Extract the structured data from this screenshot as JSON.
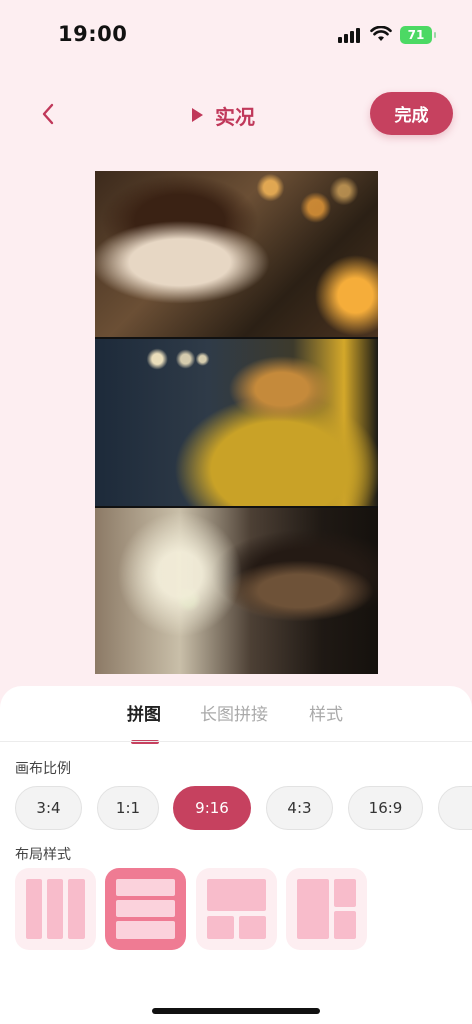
{
  "status": {
    "time": "19:00",
    "battery": "71"
  },
  "header": {
    "live_label": "实况",
    "done_label": "完成"
  },
  "tabs": [
    {
      "label": "拼图",
      "active": true
    },
    {
      "label": "长图拼接",
      "active": false
    },
    {
      "label": "样式",
      "active": false
    }
  ],
  "ratio": {
    "label": "画布比例",
    "options": [
      "3:4",
      "1:1",
      "9:16",
      "4:3",
      "16:9"
    ],
    "selected": "9:16"
  },
  "layout": {
    "label": "布局样式",
    "options": [
      "three-columns",
      "three-rows",
      "top-large-two-bottom",
      "left-large-two-right"
    ],
    "selected": "three-rows"
  },
  "colors": {
    "accent": "#c6415f",
    "background": "#fdeef1",
    "layout_active": "#ef7b93",
    "layout_cell": "#f8bccb"
  },
  "icons": [
    "back-chevron-icon",
    "play-icon",
    "signal-icon",
    "wifi-icon",
    "battery-icon"
  ]
}
